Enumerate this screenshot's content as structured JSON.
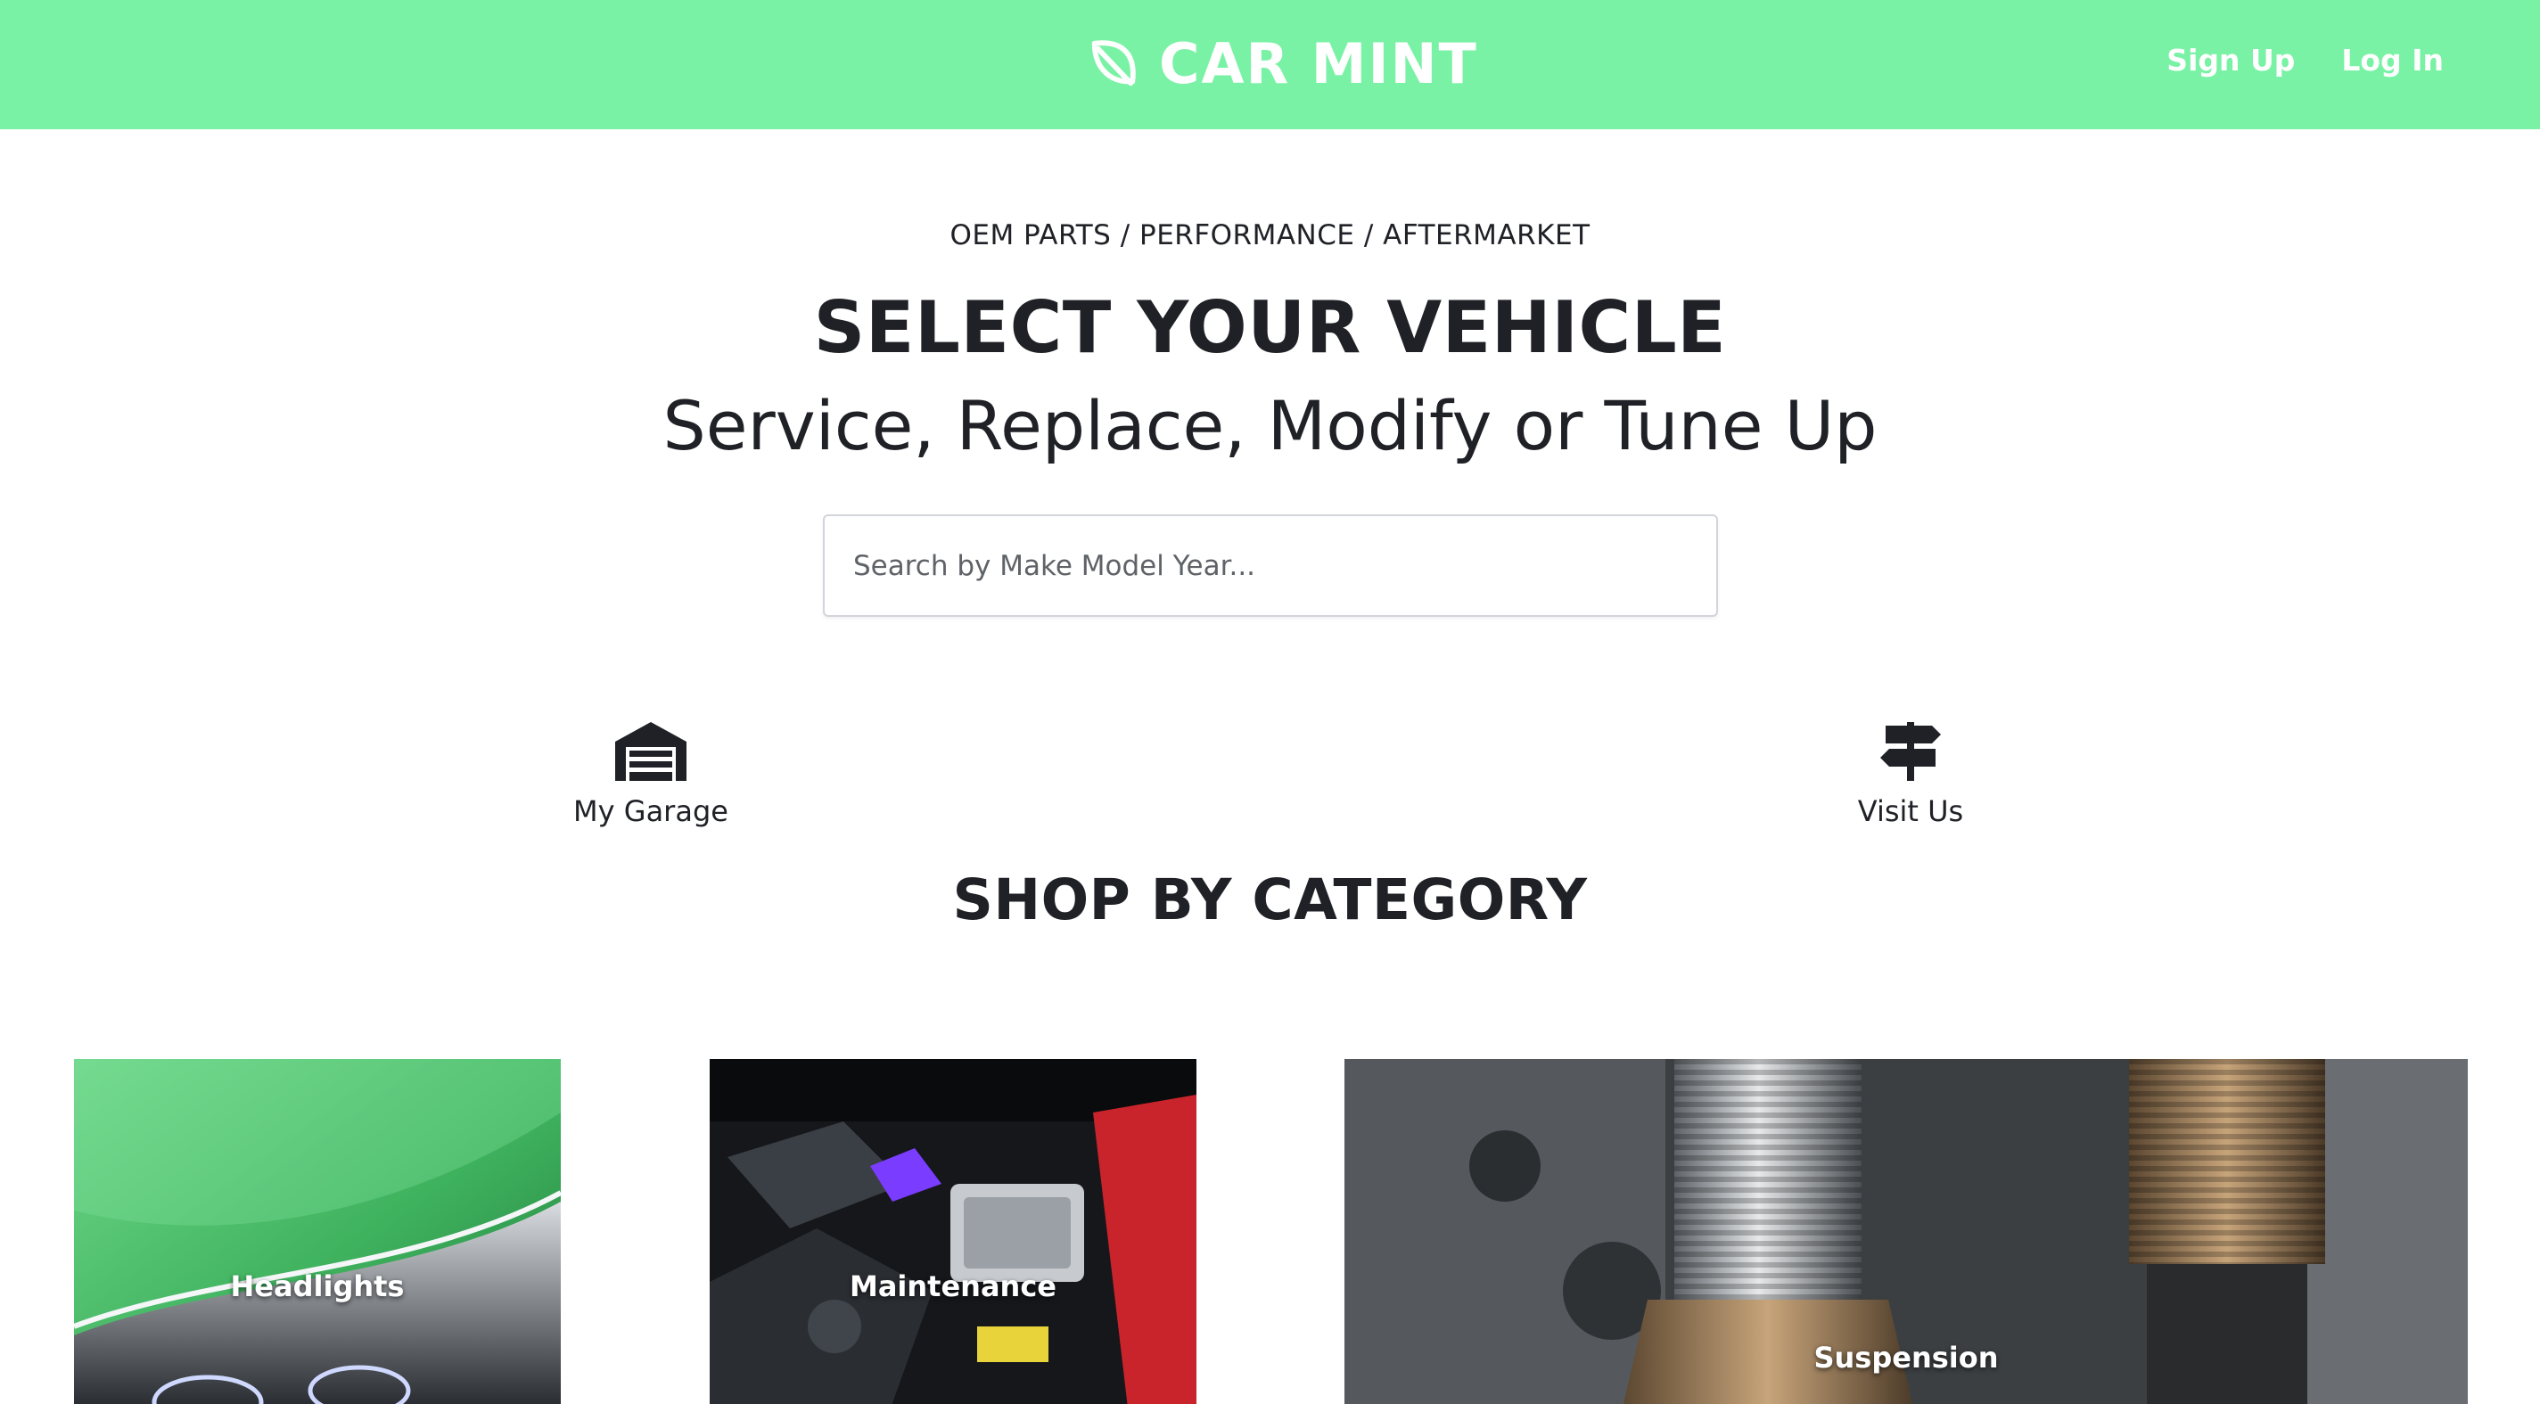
{
  "header": {
    "brand": "CAR MINT",
    "brand_icon": "leaf-icon",
    "background": "#7af2a5",
    "nav": {
      "signup_label": "Sign Up",
      "login_label": "Log In"
    }
  },
  "hero": {
    "breadcrumb": "OEM PARTS / PERFORMANCE / AFTERMARKET",
    "title": "SELECT YOUR VEHICLE",
    "subtitle": "Service, Replace, Modify or Tune Up",
    "search": {
      "placeholder": "Search by Make Model Year...",
      "value": ""
    }
  },
  "quick_links": {
    "garage": {
      "label": "My Garage",
      "icon": "garage-icon"
    },
    "visit": {
      "label": "Visit Us",
      "icon": "signpost-icon"
    }
  },
  "categories": {
    "title": "SHOP BY CATEGORY",
    "items": [
      {
        "label": "Headlights"
      },
      {
        "label": "Maintenance"
      },
      {
        "label": "Suspension"
      }
    ]
  }
}
